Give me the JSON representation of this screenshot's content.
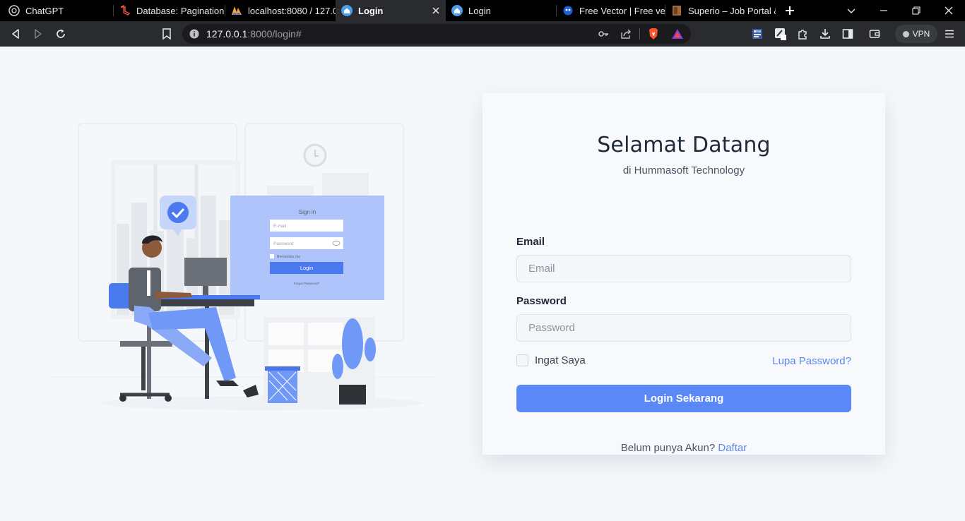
{
  "browser": {
    "tabs": [
      {
        "title": "ChatGPT",
        "icon": "chatgpt-icon",
        "active": false
      },
      {
        "title": "Database: Pagination -",
        "icon": "laravel-icon",
        "active": false
      },
      {
        "title": "localhost:8080 / 127.0.0",
        "icon": "phpmyadmin-icon",
        "active": false
      },
      {
        "title": "Login",
        "icon": "house-icon",
        "active": true
      },
      {
        "title": "Login",
        "icon": "house-icon",
        "active": false
      },
      {
        "title": "Free Vector | Free vecto",
        "icon": "freepik-icon",
        "active": false
      },
      {
        "title": "Superio – Job Portal &",
        "icon": "superio-icon",
        "active": false
      }
    ],
    "address": {
      "host": "127.0.0.1",
      "path": ":8000/login#"
    },
    "vpn_label": "VPN"
  },
  "login": {
    "title": "Selamat Datang",
    "subtitle": "di Hummasoft Technology",
    "email_label": "Email",
    "email_placeholder": "Email",
    "password_label": "Password",
    "password_placeholder": "Password",
    "remember_label": "Ingat Saya",
    "forgot_label": "Lupa Password?",
    "submit_label": "Login Sekarang",
    "signup_prompt": "Belum punya Akun?",
    "signup_link": "Daftar"
  },
  "illustration": {
    "form_title": "Sign in",
    "email_placeholder": "E-mail",
    "password_placeholder": "Password",
    "remember_label": "Remember me",
    "button_label": "Login",
    "forgot_label": "Forgot Password?"
  },
  "colors": {
    "accent": "#5a88f6",
    "link": "#5f85ee",
    "page_background": "#f5f8fb",
    "illustration_blue": "#6f98f7"
  }
}
